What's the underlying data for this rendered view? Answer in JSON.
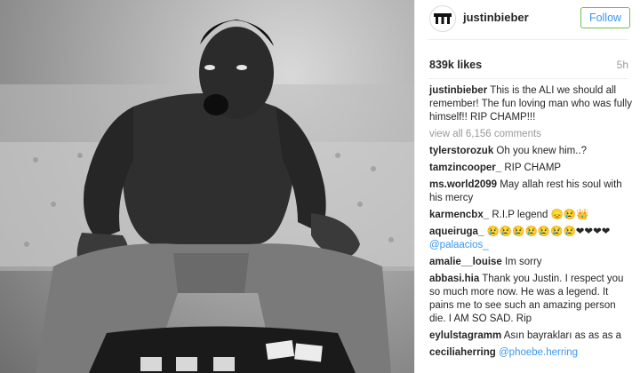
{
  "post": {
    "username": "justinbieber",
    "follow_label": "Follow",
    "likes": "839k likes",
    "time": "5h",
    "caption_user": "justinbieber",
    "caption_text": "This is the ALI we should all remember! The fun loving man who was fully himself!! RIP CHAMP!!!",
    "view_all": "view all 6,156 comments"
  },
  "comments": [
    {
      "user": "tylerstorozuk",
      "text": "Oh you knew him..?"
    },
    {
      "user": "tamzincooper_",
      "text": "RIP CHAMP"
    },
    {
      "user": "ms.world2099",
      "text": "May allah rest his soul with his mercy"
    },
    {
      "user": "karmencbx_",
      "text": "R.I.P legend 😞😢👑"
    },
    {
      "user": "aqueiruga_",
      "text": "😢😢😢😢😢😢😢❤❤❤❤",
      "mention": "@palaacios_"
    },
    {
      "user": "amalie__louise",
      "text": "Im sorry"
    },
    {
      "user": "abbasi.hia",
      "text": "Thank you Justin. I respect you so much more now. He was a legend. It pains me to see such an amazing person die. I AM SO SAD. Rip"
    },
    {
      "user": "eylulstagramm",
      "text": "Asın bayrakları as as as a"
    },
    {
      "user": "ceciliaherring",
      "text": "",
      "mention": "@phoebe.herring"
    }
  ],
  "colors": {
    "link": "#3897f0",
    "follow_border": "#70c050",
    "muted": "#999999"
  },
  "icons": {
    "avatar": "logo-avatar-icon"
  }
}
